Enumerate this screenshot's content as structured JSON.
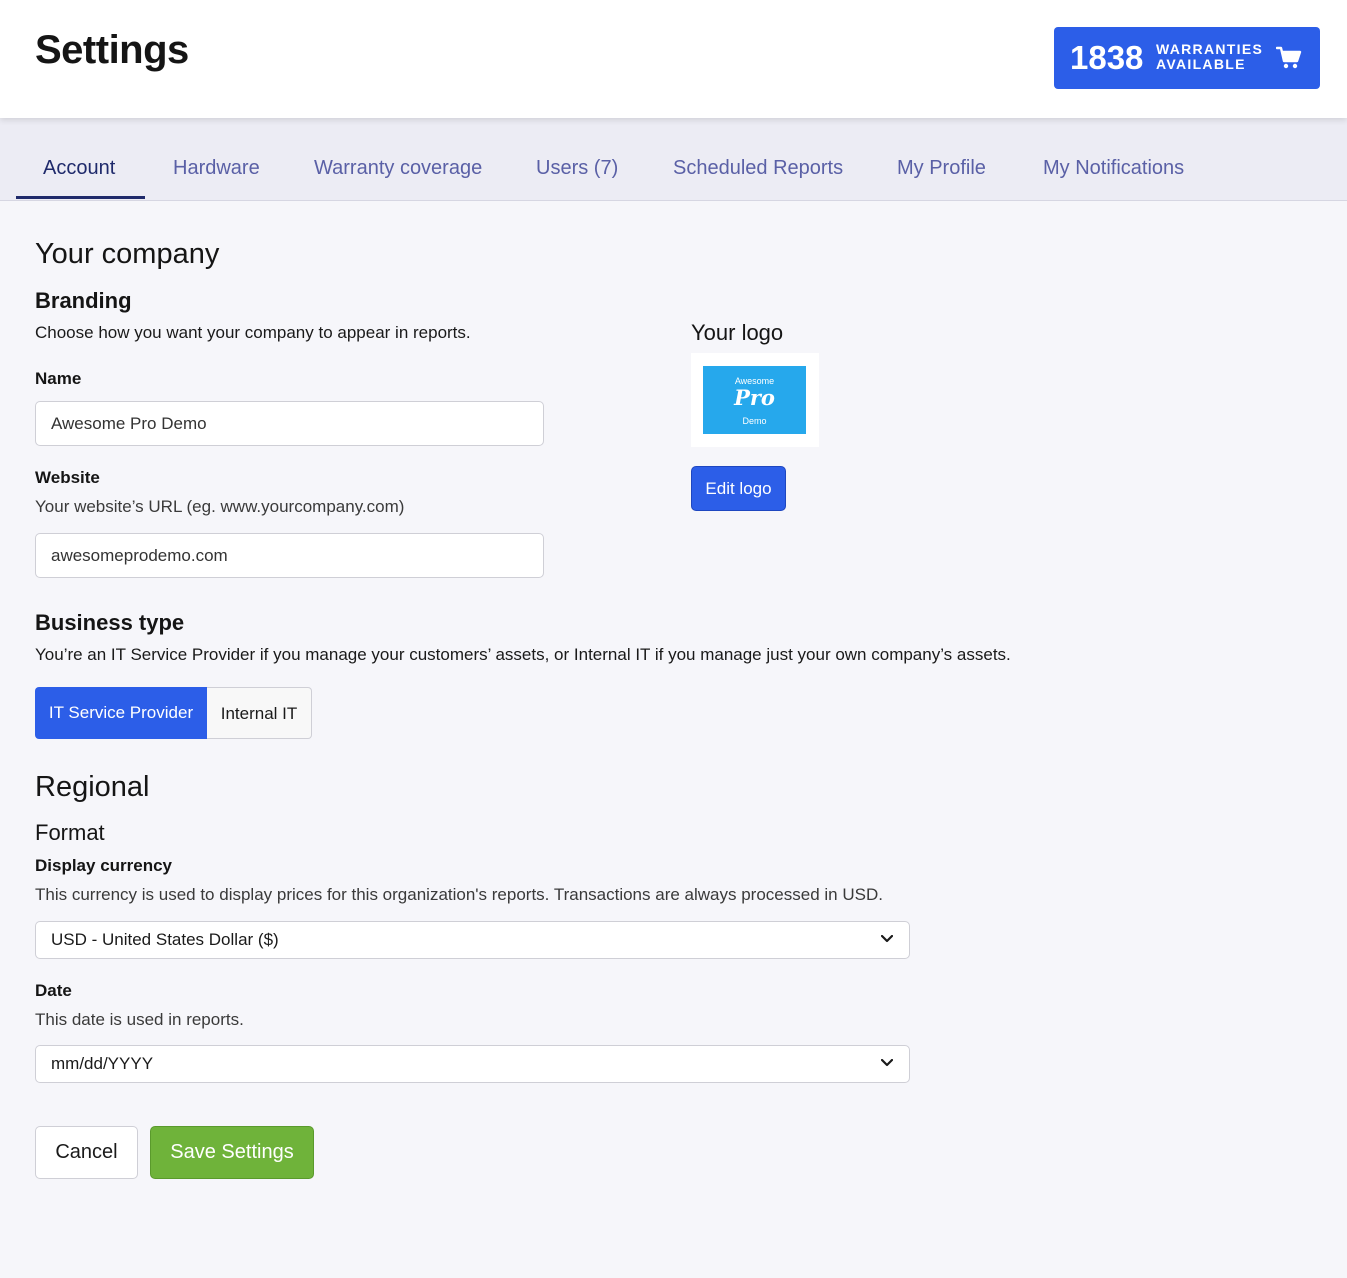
{
  "header": {
    "title": "Settings",
    "warranties": {
      "count": "1838",
      "line1": "WARRANTIES",
      "line2": "AVAILABLE",
      "icon": "shopping-cart-icon"
    }
  },
  "tabs": [
    {
      "label": "Account",
      "active": true
    },
    {
      "label": "Hardware",
      "active": false
    },
    {
      "label": "Warranty coverage",
      "active": false
    },
    {
      "label": "Users (7)",
      "active": false
    },
    {
      "label": "Scheduled Reports",
      "active": false
    },
    {
      "label": "My Profile",
      "active": false
    },
    {
      "label": "My Notifications",
      "active": false
    }
  ],
  "company": {
    "heading": "Your company",
    "branding": {
      "heading": "Branding",
      "description": "Choose how you want your company to appear in reports.",
      "name_label": "Name",
      "name_value": "Awesome Pro Demo",
      "website_label": "Website",
      "website_hint": "Your website’s URL (eg. www.yourcompany.com)",
      "website_value": "awesomeprodemo.com"
    },
    "logo": {
      "heading": "Your logo",
      "image_top": "Awesome",
      "image_main": "Pro",
      "image_bottom": "Demo",
      "edit_button": "Edit logo"
    },
    "business_type": {
      "heading": "Business type",
      "description": "You’re an IT Service Provider if you manage your customers’ assets, or Internal IT if you manage just your own company’s assets.",
      "options": [
        "IT Service Provider",
        "Internal IT"
      ],
      "selected": "IT Service Provider"
    }
  },
  "regional": {
    "heading": "Regional",
    "format_heading": "Format",
    "currency": {
      "label": "Display currency",
      "description": "This currency is used to display prices for this organization's reports. Transactions are always processed in USD.",
      "value": "USD - United States Dollar ($)"
    },
    "date": {
      "label": "Date",
      "description": "This date is used in reports.",
      "value": "mm/dd/YYYY"
    }
  },
  "actions": {
    "cancel": "Cancel",
    "save": "Save Settings"
  },
  "colors": {
    "primary": "#2c5ee8",
    "tab_active": "#1f2a6b",
    "tab_inactive": "#5a60a6",
    "save_green": "#6fb33a",
    "logo_blue": "#26a8ec"
  }
}
